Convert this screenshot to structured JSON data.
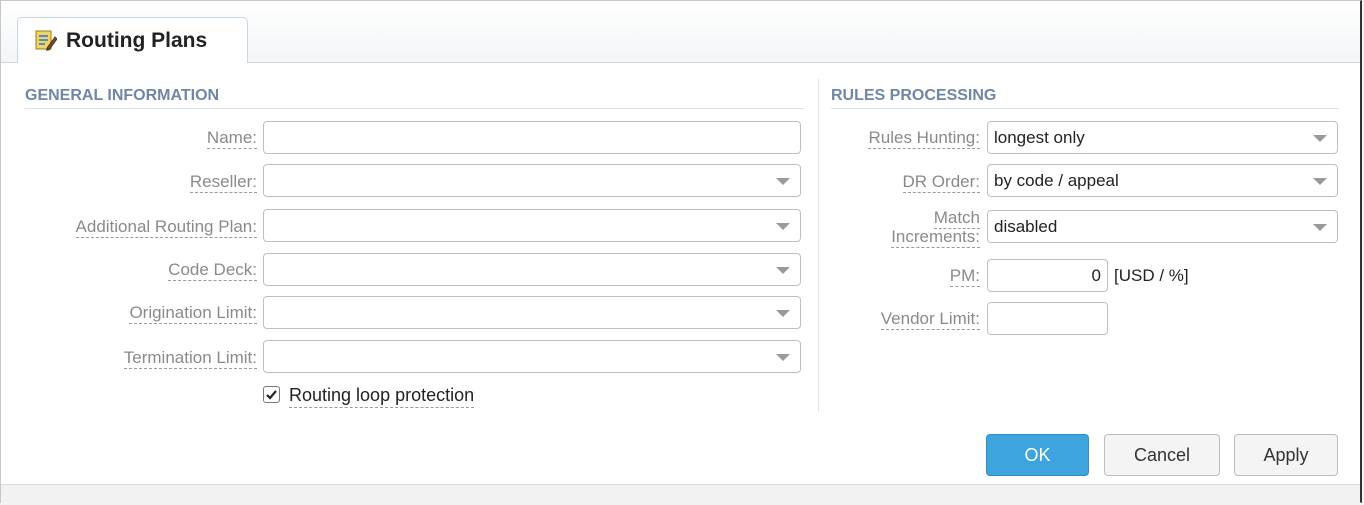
{
  "tab": {
    "title": "Routing Plans",
    "icon": "routing-plan-edit-icon"
  },
  "general": {
    "title": "GENERAL INFORMATION",
    "name_label": "Name:",
    "name_value": "",
    "reseller_label": "Reseller:",
    "reseller_value": "",
    "additional_label": "Additional Routing Plan:",
    "additional_value": "",
    "codedeck_label": "Code Deck:",
    "codedeck_value": "",
    "origination_label": "Origination Limit:",
    "origination_value": "",
    "termination_label": "Termination Limit:",
    "termination_value": "",
    "loop_label": "Routing loop protection",
    "loop_checked": true
  },
  "rules": {
    "title": "RULES PROCESSING",
    "hunting_label": "Rules Hunting:",
    "hunting_value": "longest only",
    "drorder_label": "DR Order:",
    "drorder_value": "by code / appeal",
    "match_label_1": "Match",
    "match_label_2": "Increments:",
    "match_value": "disabled",
    "pm_label": "PM:",
    "pm_value": "0",
    "pm_unit": "[USD / %]",
    "vendor_label": "Vendor Limit:",
    "vendor_value": ""
  },
  "buttons": {
    "ok": "OK",
    "cancel": "Cancel",
    "apply": "Apply"
  },
  "colors": {
    "accent": "#3ea4dd",
    "section_title": "#6f86a4"
  }
}
